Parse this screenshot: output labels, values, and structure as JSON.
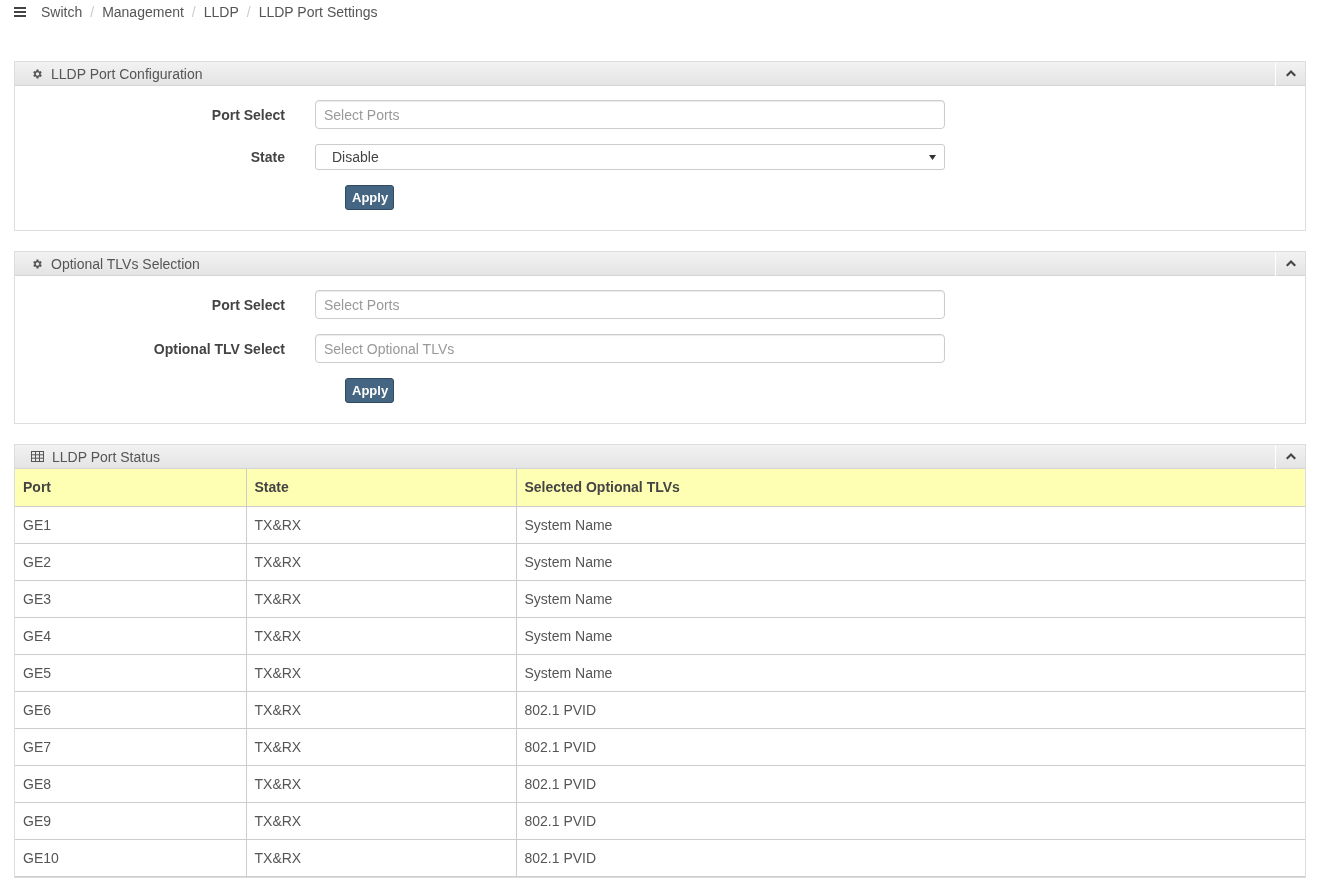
{
  "breadcrumb": [
    "Switch",
    "Management",
    "LLDP",
    "LLDP Port Settings"
  ],
  "breadcrumb_separator": "/",
  "panels": [
    {
      "kind": "form",
      "title": "LLDP Port Configuration",
      "expanded": true,
      "fields": [
        {
          "kind": "text",
          "label": "Port Select",
          "placeholder": "Select Ports"
        },
        {
          "kind": "select",
          "label": "State",
          "value": "Disable"
        }
      ],
      "button": "Apply"
    },
    {
      "kind": "form",
      "title": "Optional TLVs Selection",
      "expanded": true,
      "fields": [
        {
          "kind": "text",
          "label": "Port Select",
          "placeholder": "Select Ports"
        },
        {
          "kind": "text",
          "label": "Optional TLV Select",
          "placeholder": "Select Optional TLVs"
        }
      ],
      "button": "Apply"
    },
    {
      "kind": "table",
      "title": "LLDP Port Status",
      "expanded": true,
      "columns": [
        "Port",
        "State",
        "Selected Optional TLVs"
      ],
      "rows": [
        [
          "GE1",
          "TX&RX",
          "System Name"
        ],
        [
          "GE2",
          "TX&RX",
          "System Name"
        ],
        [
          "GE3",
          "TX&RX",
          "System Name"
        ],
        [
          "GE4",
          "TX&RX",
          "System Name"
        ],
        [
          "GE5",
          "TX&RX",
          "System Name"
        ],
        [
          "GE6",
          "TX&RX",
          "802.1 PVID"
        ],
        [
          "GE7",
          "TX&RX",
          "802.1 PVID"
        ],
        [
          "GE8",
          "TX&RX",
          "802.1 PVID"
        ],
        [
          "GE9",
          "TX&RX",
          "802.1 PVID"
        ],
        [
          "GE10",
          "TX&RX",
          "802.1 PVID"
        ]
      ]
    }
  ]
}
